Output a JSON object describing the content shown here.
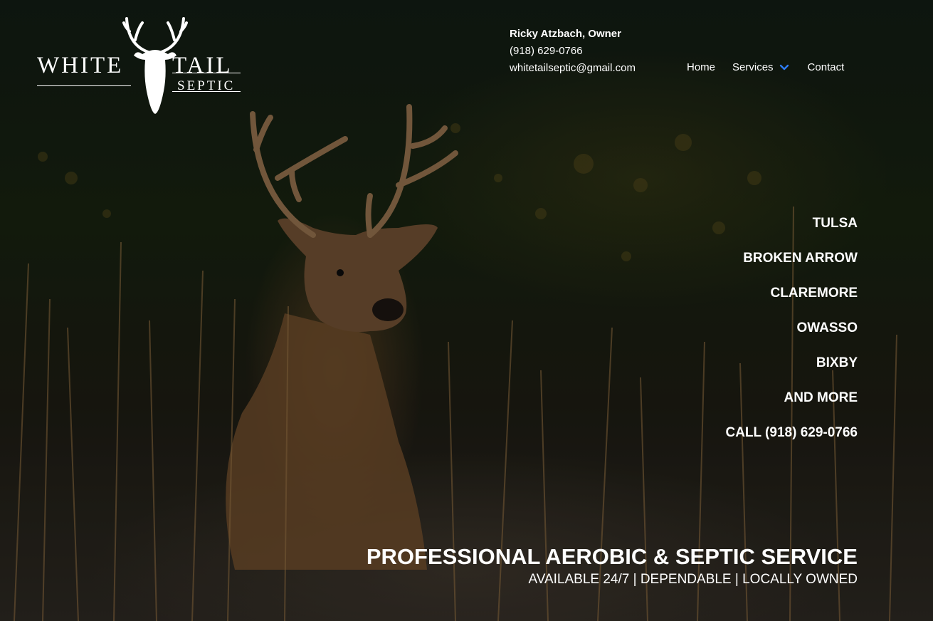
{
  "brand": {
    "word_left": "WHITE",
    "word_right": "TAIL",
    "word_sub": "SEPTIC"
  },
  "contact": {
    "owner": "Ricky Atzbach, Owner",
    "phone": "(918) 629-0766",
    "email": "whitetailseptic@gmail.com"
  },
  "nav": {
    "home": "Home",
    "services": "Services",
    "contact": "Contact"
  },
  "service_areas": [
    "TULSA",
    "BROKEN ARROW",
    "CLAREMORE",
    "OWASSO",
    "BIXBY",
    "AND MORE",
    "CALL (918) 629-0766"
  ],
  "tagline": {
    "headline": "PROFESSIONAL AEROBIC & SEPTIC SERVICE",
    "subline": "AVAILABLE 24/7 | DEPENDABLE | LOCALLY OWNED"
  },
  "colors": {
    "text": "#ffffff",
    "accent_chevron": "#2e7cf6",
    "background_dark": "#0d130e"
  },
  "icons": {
    "logo_mark": "deer-head-icon",
    "nav_dropdown": "chevron-down-icon"
  }
}
